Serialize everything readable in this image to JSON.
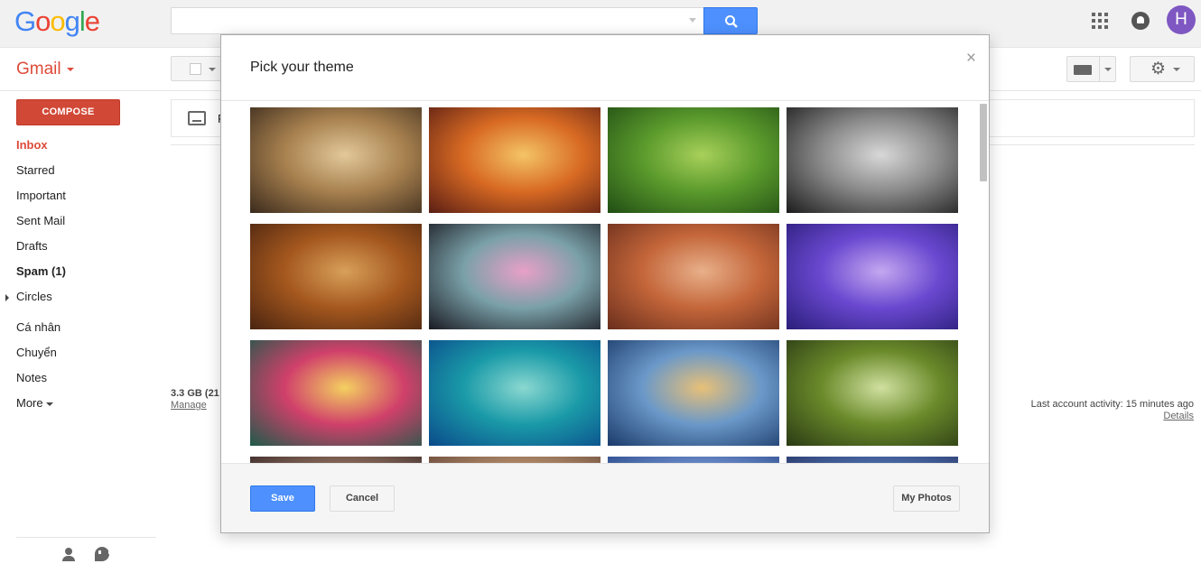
{
  "brand": {
    "logo_letters": [
      {
        "ch": "G",
        "color": "#4285f4"
      },
      {
        "ch": "o",
        "color": "#ea4335"
      },
      {
        "ch": "o",
        "color": "#fbbc05"
      },
      {
        "ch": "g",
        "color": "#4285f4"
      },
      {
        "ch": "l",
        "color": "#34a853"
      },
      {
        "ch": "e",
        "color": "#ea4335"
      }
    ],
    "app_name": "Gmail"
  },
  "header": {
    "search_value": "",
    "avatar_letter": "H"
  },
  "sidebar": {
    "compose_label": "COMPOSE",
    "items": [
      {
        "label": "Inbox",
        "state": "active"
      },
      {
        "label": "Starred",
        "state": ""
      },
      {
        "label": "Important",
        "state": ""
      },
      {
        "label": "Sent Mail",
        "state": ""
      },
      {
        "label": "Drafts",
        "state": ""
      },
      {
        "label": "Spam (1)",
        "state": "bold"
      },
      {
        "label": "Circles",
        "state": "expandable"
      },
      {
        "label": "Cá nhân",
        "state": ""
      },
      {
        "label": "Chuyển",
        "state": ""
      },
      {
        "label": "Notes",
        "state": ""
      }
    ],
    "more_label": "More"
  },
  "main": {
    "tab_label": "P",
    "storage_text": "3.3 GB (21",
    "manage_label": "Manage",
    "activity_text": "Last account activity: 15 minutes ago",
    "details_label": "Details"
  },
  "modal": {
    "title": "Pick your theme",
    "close_glyph": "×",
    "themes": [
      {
        "name": "chess",
        "colors": [
          "#3a2a1c",
          "#a8814f",
          "#e2c89a"
        ]
      },
      {
        "name": "canyon",
        "colors": [
          "#5a1e14",
          "#d86a23",
          "#f4c466"
        ]
      },
      {
        "name": "caterpillar",
        "colors": [
          "#214d14",
          "#5a9a2c",
          "#a8d05a"
        ]
      },
      {
        "name": "pipes",
        "colors": [
          "#1c1c1c",
          "#8a8a8a",
          "#d8d8d8"
        ]
      },
      {
        "name": "leaves",
        "colors": [
          "#4a2410",
          "#a5581e",
          "#d8a05a"
        ]
      },
      {
        "name": "bokeh",
        "colors": [
          "#1a1a22",
          "#7aa0a8",
          "#e8a0c8"
        ]
      },
      {
        "name": "grand-canyon",
        "colors": [
          "#6a2e1c",
          "#c4663a",
          "#e8b08a"
        ]
      },
      {
        "name": "jellyfish",
        "colors": [
          "#2a1e7a",
          "#6a48d0",
          "#c4a8f0"
        ]
      },
      {
        "name": "water-drop",
        "colors": [
          "#1e5a4a",
          "#d0406a",
          "#f4d060"
        ]
      },
      {
        "name": "lake",
        "colors": [
          "#0a4a8a",
          "#1a9aa8",
          "#8ad8d0"
        ]
      },
      {
        "name": "beach",
        "colors": [
          "#1a3a6a",
          "#6a98c8",
          "#e8c078"
        ]
      },
      {
        "name": "forest",
        "colors": [
          "#2a3a14",
          "#6a8a2a",
          "#d0e0a0"
        ]
      },
      {
        "name": "sunset",
        "colors": [
          "#3a2a2a",
          "#8a6a5a",
          "#c4a08a"
        ]
      },
      {
        "name": "desert",
        "colors": [
          "#6a4a3a",
          "#b08a6a",
          "#e0c0a0"
        ]
      },
      {
        "name": "coast",
        "colors": [
          "#2a4a8a",
          "#6a8ac8",
          "#a8c0e8"
        ]
      },
      {
        "name": "sky",
        "colors": [
          "#2a3a6a",
          "#4a6aa8",
          "#8aa8d8"
        ]
      }
    ],
    "save_label": "Save",
    "cancel_label": "Cancel",
    "my_photos_label": "My Photos"
  }
}
